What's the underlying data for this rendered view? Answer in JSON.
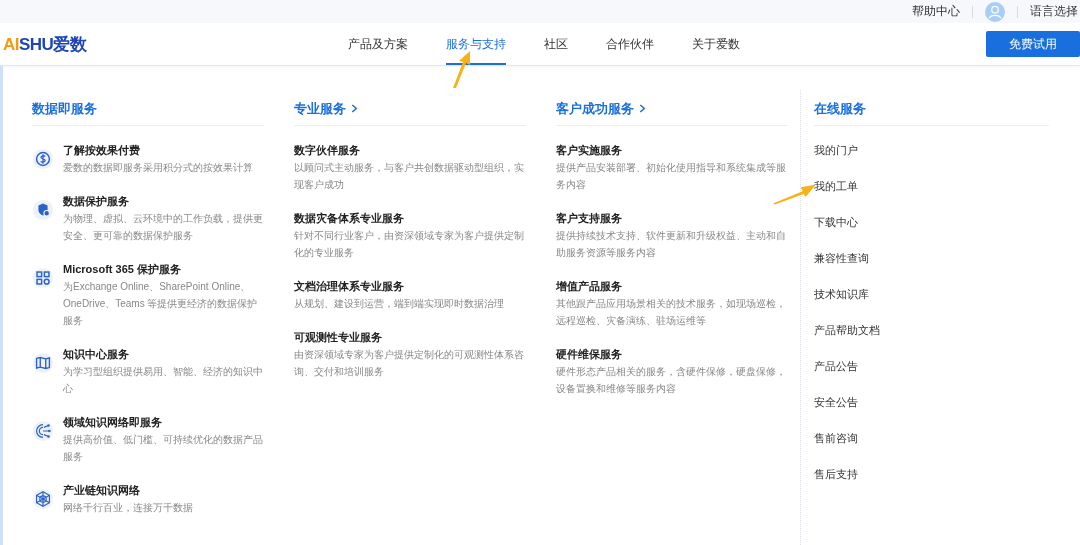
{
  "top_bar": {
    "help": "帮助中心",
    "language": "语言选择"
  },
  "logo": [
    {
      "text": "AI",
      "accent": true
    },
    {
      "text": "SHU爱数",
      "accent": false
    }
  ],
  "nav": [
    {
      "label": "产品及方案",
      "selected": false
    },
    {
      "label": "服务与支持",
      "selected": true
    },
    {
      "label": "社区",
      "selected": false
    },
    {
      "label": "合作伙伴",
      "selected": false
    },
    {
      "label": "关于爱数",
      "selected": false
    }
  ],
  "trial_button": "免费试用",
  "columns": [
    {
      "heading": "数据即服务",
      "chevron": false,
      "items": [
        {
          "kind": "dollar",
          "title": "了解按效果付费",
          "desc": "爱数的数据即服务采用积分式的按效果计算"
        },
        {
          "kind": "shield",
          "title": "数据保护服务",
          "desc": "为物理、虚拟、云环境中的工作负载，提供更安全、更可靠的数据保护服务"
        },
        {
          "kind": "grid",
          "title": "Microsoft 365 保护服务",
          "desc": "为Exchange Online、SharePoint Online、OneDrive、Teams 等提供更经济的数据保护服务"
        },
        {
          "kind": "book",
          "title": "知识中心服务",
          "desc": "为学习型组织提供易用、智能、经济的知识中心"
        },
        {
          "kind": "network",
          "title": "领域知识网络即服务",
          "desc": "提供高价值、低门槛、可持续优化的数据产品服务"
        },
        {
          "kind": "globe",
          "title": "产业链知识网络",
          "desc": "网络千行百业，连接万千数据"
        }
      ]
    },
    {
      "heading": "专业服务",
      "chevron": true,
      "items": [
        {
          "title": "数字伙伴服务",
          "desc": "以顾问式主动服务，与客户共创数据驱动型组织，实现客户成功"
        },
        {
          "title": "数据灾备体系专业服务",
          "desc": "针对不同行业客户，由资深领域专家为客户提供定制化的专业服务"
        },
        {
          "title": "文档治理体系专业服务",
          "desc": "从规划、建设到运营，端到端实现即时数据治理"
        },
        {
          "title": "可观测性专业服务",
          "desc": "由资深领域专家为客户提供定制化的可观测性体系咨询、交付和培训服务"
        }
      ]
    },
    {
      "heading": "客户成功服务",
      "chevron": true,
      "items": [
        {
          "title": "客户实施服务",
          "desc": "提供产品安装部署、初始化使用指导和系统集成等服务内容"
        },
        {
          "title": "客户支持服务",
          "desc": "提供持续技术支持、软件更新和升级权益、主动和自助服务资源等服务内容"
        },
        {
          "title": "增值产品服务",
          "desc": "其他跟产品应用场景相关的技术服务，如现场巡检，远程巡检、灾备演练、驻场运维等"
        },
        {
          "title": "硬件维保服务",
          "desc": "硬件形态产品相关的服务，含硬件保修，硬盘保修，设备置换和维修等服务内容"
        }
      ]
    }
  ],
  "online": {
    "heading": "在线服务",
    "links": [
      "我的门户",
      "我的工单",
      "下载中心",
      "兼容性查询",
      "技术知识库",
      "产品帮助文档",
      "产品公告",
      "安全公告",
      "售前咨询",
      "售后支持"
    ]
  }
}
